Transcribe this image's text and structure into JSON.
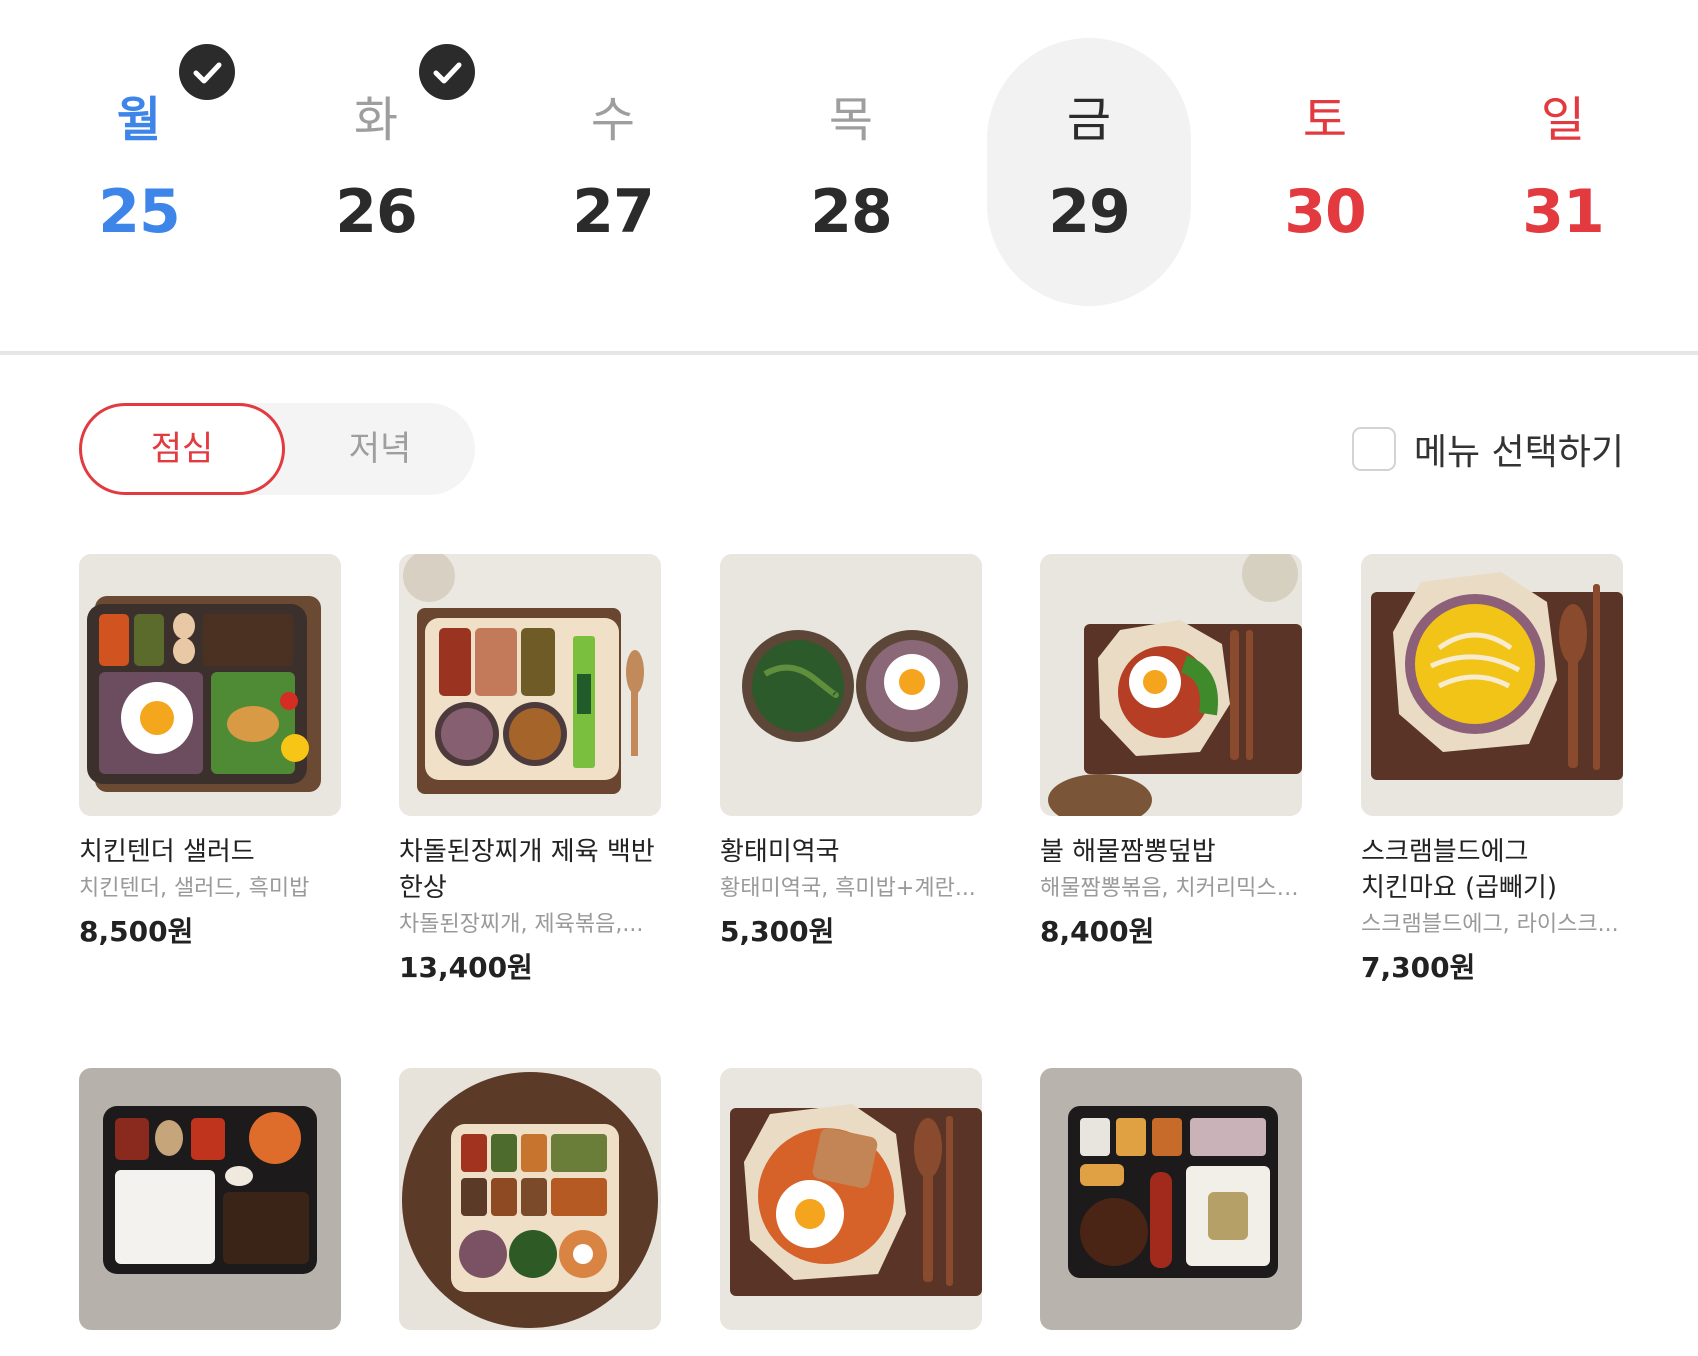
{
  "week": {
    "days": [
      {
        "weekday": "월",
        "date": "25",
        "checked": true,
        "color": "#3d85e8"
      },
      {
        "weekday": "화",
        "date": "26",
        "checked": true,
        "color": "#2b2b2b"
      },
      {
        "weekday": "수",
        "date": "27",
        "checked": false,
        "color": "#2b2b2b"
      },
      {
        "weekday": "목",
        "date": "28",
        "checked": false,
        "color": "#2b2b2b"
      },
      {
        "weekday": "금",
        "date": "29",
        "checked": false,
        "color": "#2b2b2b",
        "selected": true
      },
      {
        "weekday": "토",
        "date": "30",
        "checked": false,
        "color": "#e23a3f"
      },
      {
        "weekday": "일",
        "date": "31",
        "checked": false,
        "color": "#e23a3f"
      }
    ]
  },
  "meal_tabs": {
    "lunch": "점심",
    "dinner": "저녁",
    "active": "lunch",
    "active_color": "#e23a3f"
  },
  "select_menu": {
    "label": "메뉴 선택하기",
    "checked": false
  },
  "products": [
    {
      "name": "치킨텐더 샐러드",
      "desc": "치킨텐더, 샐러드, 흑미밥",
      "price": "8,500원",
      "image": "tray-bento-chicken-salad"
    },
    {
      "name": "차돌된장찌개 제육 백반 한상",
      "desc": "차돌된장찌개, 제육볶음,...",
      "price": "13,400원",
      "image": "tray-bento-stew"
    },
    {
      "name": "황태미역국",
      "desc": "황태미역국, 흑미밥+계란...",
      "price": "5,300원",
      "image": "two-bowls-seaweed-soup"
    },
    {
      "name": "불 해물짬뽕덮밥",
      "desc": "해물짬뽕볶음, 치커리믹스,...",
      "price": "8,400원",
      "image": "octagon-bowl-rice"
    },
    {
      "name": "스크램블드에그 치킨마요 (곱빼기)",
      "desc": "스크램블드에그, 라이스크...",
      "price": "7,300원",
      "image": "octagon-bowl-egg"
    },
    {
      "name": "",
      "desc": "",
      "price": "",
      "image": "black-tray-bulgogi"
    },
    {
      "name": "",
      "desc": "",
      "price": "",
      "image": "round-board-bento"
    },
    {
      "name": "",
      "desc": "",
      "price": "",
      "image": "octagon-bowl-fried-rice"
    },
    {
      "name": "",
      "desc": "",
      "price": "",
      "image": "black-tray-sausage"
    }
  ]
}
